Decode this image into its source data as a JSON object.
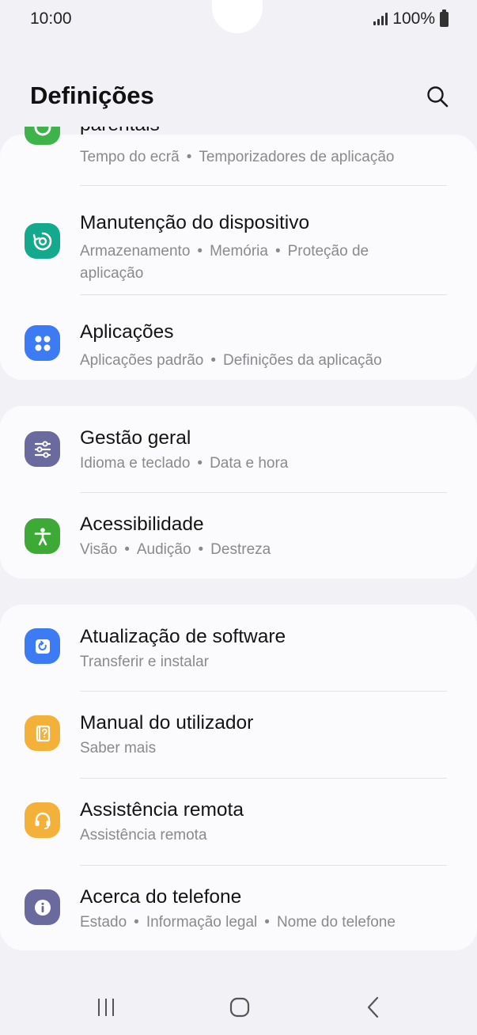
{
  "status_bar": {
    "time": "10:00",
    "battery": "100%"
  },
  "header": {
    "title": "Definições"
  },
  "items": [
    {
      "title": "parentais",
      "subtitle_parts": [
        "Tempo do ecrã",
        "Temporizadores de aplicação"
      ],
      "icon": "parental-controls-icon",
      "color": "#3db34a"
    },
    {
      "title": "Manutenção do dispositivo",
      "subtitle_parts": [
        "Armazenamento",
        "Memória",
        "Proteção de aplicação"
      ],
      "icon": "device-care-icon",
      "color": "#12a98d"
    },
    {
      "title": "Aplicações",
      "subtitle_parts": [
        "Aplicações padrão",
        "Definições da aplicação"
      ],
      "icon": "apps-icon",
      "color": "#3c7bf3"
    },
    {
      "title": "Gestão geral",
      "subtitle_parts": [
        "Idioma e teclado",
        "Data e hora"
      ],
      "icon": "general-management-icon",
      "color": "#6a6a9f"
    },
    {
      "title": "Acessibilidade",
      "subtitle_parts": [
        "Visão",
        "Audição",
        "Destreza"
      ],
      "icon": "accessibility-icon",
      "color": "#3daa35"
    },
    {
      "title": "Atualização de software",
      "subtitle_parts": [
        "Transferir e instalar"
      ],
      "icon": "software-update-icon",
      "color": "#3c7bf3"
    },
    {
      "title": "Manual do utilizador",
      "subtitle_parts": [
        "Saber mais"
      ],
      "icon": "user-manual-icon",
      "color": "#f4b13a"
    },
    {
      "title": "Assistência remota",
      "subtitle_parts": [
        "Assistência remota"
      ],
      "icon": "remote-support-icon",
      "color": "#f4b13a"
    },
    {
      "title": "Acerca do telefone",
      "subtitle_parts": [
        "Estado",
        "Informação legal",
        "Nome do telefone"
      ],
      "icon": "about-phone-icon",
      "color": "#6a6a9f"
    }
  ],
  "nav": {
    "recents": "recents-icon",
    "home": "home-icon",
    "back": "back-icon"
  }
}
